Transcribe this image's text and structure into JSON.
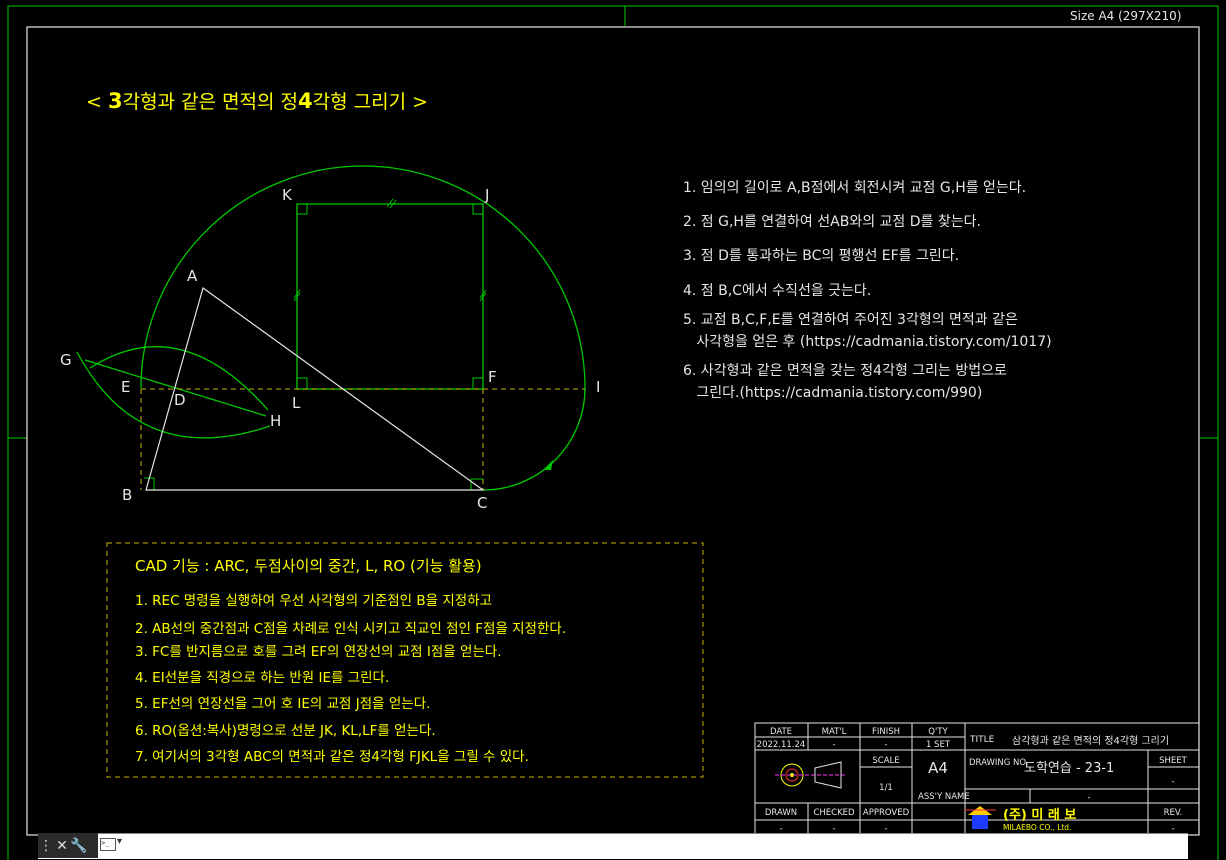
{
  "sheet": {
    "size_label": "Size A4 (297X210)"
  },
  "heading": {
    "open": "< ",
    "num1": "3",
    "part1": "각형과 같은 면적의 정",
    "num2": "4",
    "part2": "각형 그리기 >"
  },
  "points": {
    "A": "A",
    "B": "B",
    "C": "C",
    "D": "D",
    "E": "E",
    "F": "F",
    "G": "G",
    "H": "H",
    "I": "I",
    "J": "J",
    "K": "K",
    "L": "L"
  },
  "steps": [
    "1. 임의의 길이로 A,B점에서 회전시켜 교점 G,H를 얻는다.",
    "2. 점 G,H를 연결하여 선AB와의 교점 D를 찾는다.",
    "3. 점 D를 통과하는 BC의 평행선 EF를 그린다.",
    "4. 점 B,C에서 수직선을 긋는다.",
    "5. 교점 B,C,F,E를 연결하여 주어진 3각형의 면적과 같은",
    "   사각형을 얻은 후 (https://cadmania.tistory.com/1017)",
    "6. 사각형과 같은 면적을 갖는 정4각형 그리는 방법으로",
    "   그린다.(https://cadmania.tistory.com/990)"
  ],
  "cad_box": {
    "title": "CAD 기능 :  ARC, 두점사이의 중간, L, RO (기능 활용)",
    "items": [
      "1. REC 명령을 실행하여 우선 사각형의 기준점인 B을 지정하고",
      "2. AB선의 중간점과 C점을 차례로 인식 시키고 직교인 점인 F점을 지정한다.",
      "3. FC를 반지름으로 호를 그려 EF의 연장선의 교점 I점을 얻는다.",
      "4. EI선분을 직경으로 하는 반원 IE를 그린다.",
      "5. EF선의 연장선을 그어 호 IE의 교점 J점을 얻는다.",
      "6. RO(옵션:복사)명령으로 선분 JK, KL,LF를 얻는다.",
      "7. 여기서의 3각형 ABC의 면적과 같은 정4각형 FJKL을 그릴 수 있다."
    ]
  },
  "title_block": {
    "date_label": "DATE",
    "date_value": "2022.11.24",
    "matl_label": "MAT'L",
    "matl_value": "-",
    "finish_label": "FINISH",
    "finish_value": "-",
    "qty_label": "Q'TY",
    "qty_value": "1 SET",
    "title_label": "TITLE",
    "title_value": "삼각형과 같은 면적의 정4각형 그리기",
    "scale_label": "SCALE",
    "scale_value": "1/1",
    "size_value": "A4",
    "drawing_no_label": "DRAWING NO.",
    "drawing_no_value": "도학연습 - 23-1",
    "sheet_label": "SHEET",
    "sheet_value": "-",
    "assy_label": "ASS'Y NAME",
    "assy_value": "-",
    "drawn_label": "DRAWN",
    "drawn_value": "-",
    "checked_label": "CHECKED",
    "checked_value": "-",
    "approved_label": "APPROVED",
    "approved_value": "-",
    "rev_label": "REV.",
    "rev_value": "-",
    "company_name": "(주) 미 래 보",
    "company_sub": "MILAEBO CO., Ltd."
  },
  "command_line": {
    "value": "",
    "close_icon": "close-icon",
    "settings_icon": "wrench-icon",
    "prompt_icon": "command-prompt-icon"
  },
  "colors": {
    "green": "#00c800",
    "yellow": "#ffff00",
    "white": "#e6e6e6",
    "dashed": "#c8b400"
  }
}
